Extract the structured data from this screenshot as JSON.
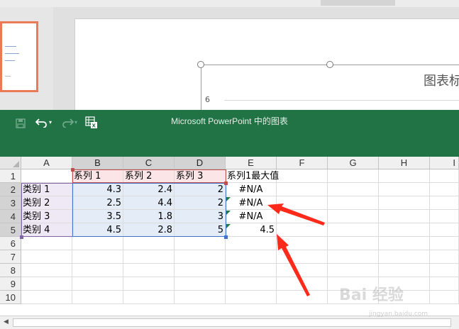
{
  "powerpoint": {
    "chart_title": "图表标",
    "axis_label": "6"
  },
  "excel": {
    "window_title": "Microsoft PowerPoint 中的图表",
    "quick_access": {
      "save_icon": "save-icon",
      "undo_icon": "undo-icon",
      "redo_icon": "redo-icon",
      "edit_data_icon": "edit-data-in-excel-icon"
    },
    "columns": [
      "A",
      "B",
      "C",
      "D",
      "E",
      "F",
      "G",
      "H",
      "I"
    ],
    "rows": [
      "1",
      "2",
      "3",
      "4",
      "5",
      "6",
      "7",
      "8",
      "9",
      "10"
    ],
    "cells": {
      "B1": "系列 1",
      "C1": "系列 2",
      "D1": "系列 3",
      "E1": "系列1最大值",
      "A2": "类别 1",
      "B2": "4.3",
      "C2": "2.4",
      "D2": "2",
      "E2": "#N/A",
      "A3": "类别 2",
      "B3": "2.5",
      "C3": "4.4",
      "D3": "2",
      "E3": "#N/A",
      "A4": "类别 3",
      "B4": "3.5",
      "C4": "1.8",
      "D4": "3",
      "E4": "#N/A",
      "A5": "类别 4",
      "B5": "4.5",
      "C5": "2.8",
      "D5": "5",
      "E5": "4.5"
    }
  },
  "colors": {
    "excel_green": "#217346",
    "series_range": "#c0504d",
    "category_range": "#8064a2",
    "values_range": "#4472c4",
    "annotation_arrow": "#ff2a1a"
  },
  "watermark": {
    "text": "Bai 经验",
    "sub": "jingyan.baidu.com"
  }
}
